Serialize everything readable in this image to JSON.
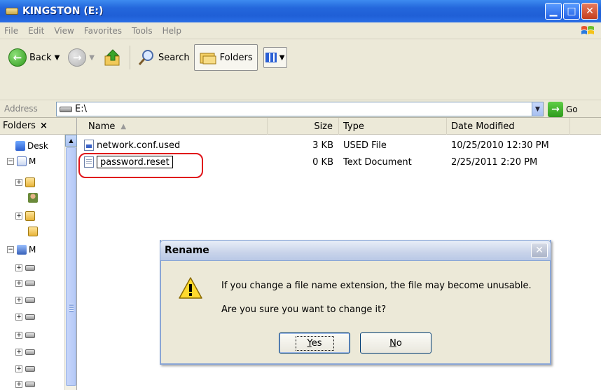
{
  "window": {
    "title": "KINGSTON (E:)"
  },
  "menu": [
    "File",
    "Edit",
    "View",
    "Favorites",
    "Tools",
    "Help"
  ],
  "toolbar": {
    "back_label": "Back",
    "search_label": "Search",
    "folders_label": "Folders"
  },
  "address": {
    "label": "Address",
    "value": "E:\\",
    "go_label": "Go"
  },
  "folders_pane": {
    "title": "Folders",
    "close_glyph": "×",
    "tree": [
      {
        "label": "Desk",
        "icon": "desktop-icon",
        "pm": ""
      },
      {
        "label": "M",
        "icon": "my-documents-icon",
        "pm": "−"
      },
      {
        "label": "",
        "icon": "folder-icon",
        "pm": "+"
      },
      {
        "label": "",
        "icon": "person-icon",
        "pm": ""
      },
      {
        "label": "",
        "icon": "folder-icon",
        "pm": "+"
      },
      {
        "label": "",
        "icon": "folder-icon",
        "pm": ""
      },
      {
        "label": "M",
        "icon": "my-computer-icon",
        "pm": "−"
      },
      {
        "label": "",
        "icon": "drive-icon",
        "pm": "+"
      },
      {
        "label": "",
        "icon": "drive-icon",
        "pm": "+"
      },
      {
        "label": "",
        "icon": "drive-icon",
        "pm": "+"
      },
      {
        "label": "",
        "icon": "drive-icon",
        "pm": "+"
      },
      {
        "label": "",
        "icon": "drive-icon",
        "pm": "+"
      },
      {
        "label": "",
        "icon": "drive-icon",
        "pm": "+"
      },
      {
        "label": "",
        "icon": "drive-icon",
        "pm": "+"
      },
      {
        "label": "",
        "icon": "drive-icon",
        "pm": "+"
      }
    ]
  },
  "file_list": {
    "columns": {
      "name": "Name",
      "size": "Size",
      "type": "Type",
      "date": "Date Modified"
    },
    "rows": [
      {
        "name": "network.conf.used",
        "size": "3 KB",
        "type": "USED File",
        "date": "10/25/2010 12:30 PM",
        "icon": "config-file-icon"
      },
      {
        "name": "password.reset",
        "size": "0 KB",
        "type": "Text Document",
        "date": "2/25/2011 2:20 PM",
        "icon": "text-file-icon"
      }
    ]
  },
  "dialog": {
    "title": "Rename",
    "message1": "If you change a file name extension, the file may become unusable.",
    "message2": "Are you sure you want to change it?",
    "yes_label_first": "Y",
    "yes_label_rest": "es",
    "no_label_first": "N",
    "no_label_rest": "o"
  }
}
